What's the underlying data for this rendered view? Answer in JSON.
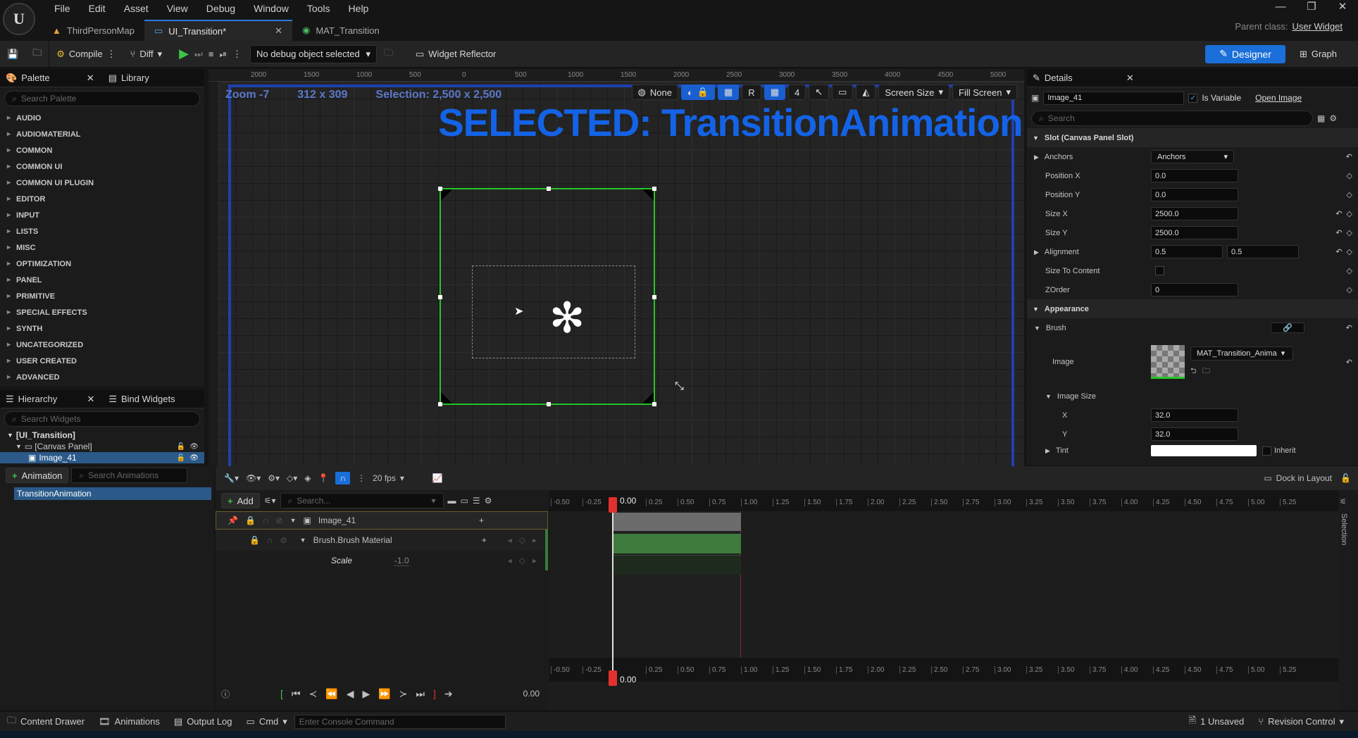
{
  "menu": [
    "File",
    "Edit",
    "Asset",
    "View",
    "Debug",
    "Window",
    "Tools",
    "Help"
  ],
  "tabs": [
    {
      "label": "ThirdPersonMap"
    },
    {
      "label": "UI_Transition*"
    },
    {
      "label": "MAT_Transition"
    }
  ],
  "parent_class": {
    "label": "Parent class:",
    "value": "User Widget"
  },
  "toolbar": {
    "compile": "Compile",
    "diff": "Diff",
    "debug_object": "No debug object selected",
    "widget_reflector": "Widget Reflector",
    "designer": "Designer",
    "graph": "Graph"
  },
  "palette": {
    "title": "Palette",
    "library": "Library",
    "search_placeholder": "Search Palette",
    "categories": [
      "AUDIO",
      "AUDIOMATERIAL",
      "COMMON",
      "COMMON UI",
      "COMMON UI PLUGIN",
      "EDITOR",
      "INPUT",
      "LISTS",
      "MISC",
      "OPTIMIZATION",
      "PANEL",
      "PRIMITIVE",
      "SPECIAL EFFECTS",
      "SYNTH",
      "UNCATEGORIZED",
      "USER CREATED",
      "ADVANCED"
    ]
  },
  "hierarchy": {
    "title": "Hierarchy",
    "bind": "Bind Widgets",
    "search_placeholder": "Search Widgets",
    "items": [
      "[UI_Transition]",
      "[Canvas Panel]",
      "Image_41"
    ]
  },
  "canvas": {
    "zoom": "Zoom -7",
    "size": "312 x 309",
    "selection": "Selection: 2,500 x 2,500",
    "banner": "SELECTED: TransitionAnimation",
    "none": "None",
    "r": "R",
    "grid": "4",
    "screen_size": "Screen Size",
    "fill_screen": "Fill Screen",
    "ruler": [
      "2000",
      "1500",
      "1000",
      "500",
      "0",
      "500",
      "1000",
      "1500",
      "2000",
      "2500",
      "3000",
      "3500",
      "4000",
      "4500",
      "5000"
    ]
  },
  "details": {
    "title": "Details",
    "name": "Image_41",
    "is_variable": "Is Variable",
    "open_image": "Open Image",
    "search_placeholder": "Search",
    "slot_section": "Slot (Canvas Panel Slot)",
    "anchors_label": "Anchors",
    "anchors_value": "Anchors",
    "position_x": {
      "label": "Position X",
      "value": "0.0"
    },
    "position_y": {
      "label": "Position Y",
      "value": "0.0"
    },
    "size_x": {
      "label": "Size X",
      "value": "2500.0"
    },
    "size_y": {
      "label": "Size Y",
      "value": "2500.0"
    },
    "alignment": {
      "label": "Alignment",
      "x": "0.5",
      "y": "0.5"
    },
    "size_to_content": "Size To Content",
    "zorder": {
      "label": "ZOrder",
      "value": "0"
    },
    "appearance": "Appearance",
    "brush": "Brush",
    "image_label": "Image",
    "image_value": "MAT_Transition_Anima",
    "image_size": "Image Size",
    "is_x": {
      "label": "X",
      "value": "32.0"
    },
    "is_y": {
      "label": "Y",
      "value": "32.0"
    },
    "tint": "Tint",
    "inherit": "Inherit"
  },
  "animations": {
    "add": "Animation",
    "search_placeholder": "Search Animations",
    "items": [
      "TransitionAnimation"
    ]
  },
  "sequencer": {
    "fps": "20 fps",
    "time": "0.00",
    "add": "Add",
    "search_placeholder": "Search...",
    "tracks": [
      {
        "label": "Image_41"
      },
      {
        "label": "Brush.Brush Material"
      },
      {
        "label": "Scale",
        "value": "-1.0"
      }
    ],
    "dock": "Dock in Layout",
    "selection": "Selection",
    "ticks": [
      "-0.50",
      "-0.25",
      "0.00",
      "0.25",
      "0.50",
      "0.75",
      "1.00",
      "1.25",
      "1.50",
      "1.75",
      "2.00",
      "2.25",
      "2.50",
      "2.75",
      "3.00",
      "3.25",
      "3.50",
      "3.75",
      "4.00",
      "4.25",
      "4.50",
      "4.75",
      "5.00",
      "5.25"
    ],
    "bottom_time": "0.00"
  },
  "statusbar": {
    "content_drawer": "Content Drawer",
    "animations": "Animations",
    "output_log": "Output Log",
    "cmd": "Cmd",
    "console_placeholder": "Enter Console Command",
    "unsaved": "1 Unsaved",
    "revision": "Revision Control"
  },
  "colors": {
    "accent": "#1a6fd8",
    "banner": "#1463e6",
    "selection_green": "#27c42a",
    "key_red": "#e23030"
  }
}
